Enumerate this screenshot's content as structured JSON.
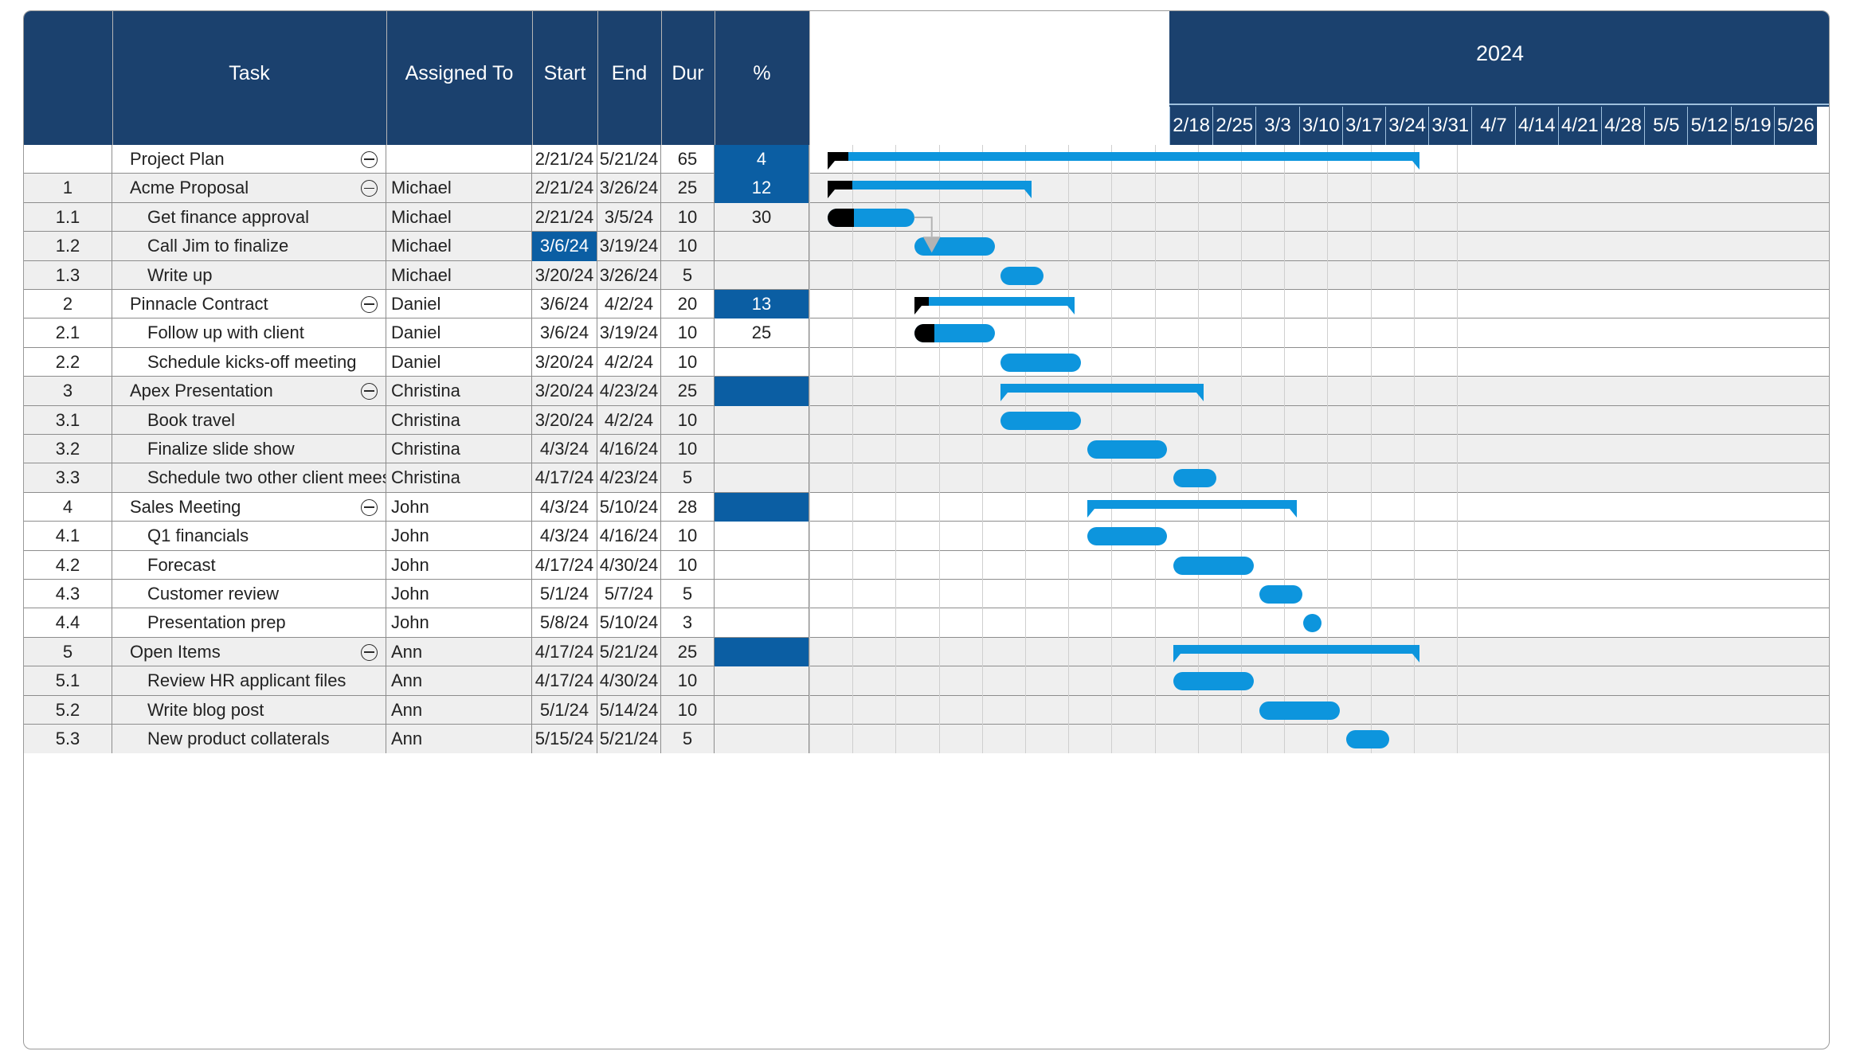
{
  "table": {
    "columns": [
      {
        "key": "id",
        "label": ""
      },
      {
        "key": "task",
        "label": "Task"
      },
      {
        "key": "assigned",
        "label": "Assigned To"
      },
      {
        "key": "start",
        "label": "Start"
      },
      {
        "key": "end",
        "label": "End"
      },
      {
        "key": "dur",
        "label": "Dur"
      },
      {
        "key": "pct",
        "label": "%"
      }
    ]
  },
  "timeline": {
    "year": "2024",
    "week_labels": [
      "2/18",
      "2/25",
      "3/3",
      "3/10",
      "3/17",
      "3/24",
      "3/31",
      "4/7",
      "4/14",
      "4/21",
      "4/28",
      "5/5",
      "5/12",
      "5/19",
      "5/26"
    ]
  },
  "colors": {
    "header_navy": "#1b416e",
    "highlight_blue": "#0b5ea3",
    "bar_blue": "#0d95dd",
    "progress_black": "#000000",
    "row_alt": "#efefef",
    "grid_line": "#8d8d8d"
  },
  "rows": [
    {
      "id": "",
      "task": "Project Plan",
      "level": 0,
      "summary": true,
      "collapse": true,
      "assigned": "",
      "start": "2/21/24",
      "end": "5/21/24",
      "dur": "65",
      "pct": "4",
      "pct_hl": true,
      "start_hl": false,
      "band": "white",
      "bar": {
        "type": "summary",
        "start_week": 0.43,
        "end_week": 14.14,
        "progress": 0.035
      }
    },
    {
      "id": "1",
      "task": "Acme Proposal",
      "level": 0,
      "summary": true,
      "collapse": true,
      "assigned": "Michael",
      "start": "2/21/24",
      "end": "3/26/24",
      "dur": "25",
      "pct": "12",
      "pct_hl": true,
      "start_hl": false,
      "band": "alt",
      "bar": {
        "type": "summary",
        "start_week": 0.43,
        "end_week": 5.14,
        "progress": 0.12
      }
    },
    {
      "id": "1.1",
      "task": "Get finance approval",
      "level": 1,
      "summary": false,
      "collapse": false,
      "assigned": "Michael",
      "start": "2/21/24",
      "end": "3/5/24",
      "dur": "10",
      "pct": "30",
      "pct_hl": false,
      "start_hl": false,
      "band": "alt",
      "bar": {
        "type": "task",
        "start_week": 0.43,
        "end_week": 2.43,
        "progress": 0.3
      }
    },
    {
      "id": "1.2",
      "task": "Call Jim to finalize",
      "level": 1,
      "summary": false,
      "collapse": false,
      "assigned": "Michael",
      "start": "3/6/24",
      "end": "3/19/24",
      "dur": "10",
      "pct": "",
      "pct_hl": false,
      "start_hl": true,
      "band": "alt",
      "bar": {
        "type": "task",
        "start_week": 2.43,
        "end_week": 4.29,
        "progress": 0
      }
    },
    {
      "id": "1.3",
      "task": "Write up",
      "level": 1,
      "summary": false,
      "collapse": false,
      "assigned": "Michael",
      "start": "3/20/24",
      "end": "3/26/24",
      "dur": "5",
      "pct": "",
      "pct_hl": false,
      "start_hl": false,
      "band": "alt",
      "bar": {
        "type": "task",
        "start_week": 4.43,
        "end_week": 5.43,
        "progress": 0
      }
    },
    {
      "id": "2",
      "task": "Pinnacle Contract",
      "level": 0,
      "summary": true,
      "collapse": true,
      "assigned": "Daniel",
      "start": "3/6/24",
      "end": "4/2/24",
      "dur": "20",
      "pct": "13",
      "pct_hl": true,
      "start_hl": false,
      "band": "white",
      "bar": {
        "type": "summary",
        "start_week": 2.43,
        "end_week": 6.14,
        "progress": 0.09
      }
    },
    {
      "id": "2.1",
      "task": "Follow up with client",
      "level": 1,
      "summary": false,
      "collapse": false,
      "assigned": "Daniel",
      "start": "3/6/24",
      "end": "3/19/24",
      "dur": "10",
      "pct": "25",
      "pct_hl": false,
      "start_hl": false,
      "band": "white",
      "bar": {
        "type": "task",
        "start_week": 2.43,
        "end_week": 4.29,
        "progress": 0.25
      }
    },
    {
      "id": "2.2",
      "task": "Schedule kicks-off meeting",
      "level": 1,
      "summary": false,
      "collapse": false,
      "assigned": "Daniel",
      "start": "3/20/24",
      "end": "4/2/24",
      "dur": "10",
      "pct": "",
      "pct_hl": false,
      "start_hl": false,
      "band": "white",
      "bar": {
        "type": "task",
        "start_week": 4.43,
        "end_week": 6.29,
        "progress": 0
      }
    },
    {
      "id": "3",
      "task": "Apex Presentation",
      "level": 0,
      "summary": true,
      "collapse": true,
      "assigned": "Christina",
      "start": "3/20/24",
      "end": "4/23/24",
      "dur": "25",
      "pct": "",
      "pct_hl": true,
      "start_hl": false,
      "band": "alt",
      "bar": {
        "type": "summary",
        "start_week": 4.43,
        "end_week": 9.14,
        "progress": 0
      }
    },
    {
      "id": "3.1",
      "task": "Book travel",
      "level": 1,
      "summary": false,
      "collapse": false,
      "assigned": "Christina",
      "start": "3/20/24",
      "end": "4/2/24",
      "dur": "10",
      "pct": "",
      "pct_hl": false,
      "start_hl": false,
      "band": "alt",
      "bar": {
        "type": "task",
        "start_week": 4.43,
        "end_week": 6.29,
        "progress": 0
      }
    },
    {
      "id": "3.2",
      "task": "Finalize slide show",
      "level": 1,
      "summary": false,
      "collapse": false,
      "assigned": "Christina",
      "start": "4/3/24",
      "end": "4/16/24",
      "dur": "10",
      "pct": "",
      "pct_hl": false,
      "start_hl": false,
      "band": "alt",
      "bar": {
        "type": "task",
        "start_week": 6.43,
        "end_week": 8.29,
        "progress": 0
      }
    },
    {
      "id": "3.3",
      "task": "Schedule two other client meestings",
      "level": 1,
      "summary": false,
      "collapse": false,
      "assigned": "Christina",
      "start": "4/17/24",
      "end": "4/23/24",
      "dur": "5",
      "pct": "",
      "pct_hl": false,
      "start_hl": false,
      "band": "alt",
      "bar": {
        "type": "task",
        "start_week": 8.43,
        "end_week": 9.43,
        "progress": 0
      }
    },
    {
      "id": "4",
      "task": "Sales Meeting",
      "level": 0,
      "summary": true,
      "collapse": true,
      "assigned": "John",
      "start": "4/3/24",
      "end": "5/10/24",
      "dur": "28",
      "pct": "",
      "pct_hl": true,
      "start_hl": false,
      "band": "white",
      "bar": {
        "type": "summary",
        "start_week": 6.43,
        "end_week": 11.29,
        "progress": 0
      }
    },
    {
      "id": "4.1",
      "task": "Q1 financials",
      "level": 1,
      "summary": false,
      "collapse": false,
      "assigned": "John",
      "start": "4/3/24",
      "end": "4/16/24",
      "dur": "10",
      "pct": "",
      "pct_hl": false,
      "start_hl": false,
      "band": "white",
      "bar": {
        "type": "task",
        "start_week": 6.43,
        "end_week": 8.29,
        "progress": 0
      }
    },
    {
      "id": "4.2",
      "task": "Forecast",
      "level": 1,
      "summary": false,
      "collapse": false,
      "assigned": "John",
      "start": "4/17/24",
      "end": "4/30/24",
      "dur": "10",
      "pct": "",
      "pct_hl": false,
      "start_hl": false,
      "band": "white",
      "bar": {
        "type": "task",
        "start_week": 8.43,
        "end_week": 10.29,
        "progress": 0
      }
    },
    {
      "id": "4.3",
      "task": "Customer review",
      "level": 1,
      "summary": false,
      "collapse": false,
      "assigned": "John",
      "start": "5/1/24",
      "end": "5/7/24",
      "dur": "5",
      "pct": "",
      "pct_hl": false,
      "start_hl": false,
      "band": "white",
      "bar": {
        "type": "task",
        "start_week": 10.43,
        "end_week": 11.43,
        "progress": 0
      }
    },
    {
      "id": "4.4",
      "task": "Presentation prep",
      "level": 1,
      "summary": false,
      "collapse": false,
      "assigned": "John",
      "start": "5/8/24",
      "end": "5/10/24",
      "dur": "3",
      "pct": "",
      "pct_hl": false,
      "start_hl": false,
      "band": "white",
      "bar": {
        "type": "task",
        "start_week": 11.43,
        "end_week": 11.86,
        "progress": 0
      }
    },
    {
      "id": "5",
      "task": "Open Items",
      "level": 0,
      "summary": true,
      "collapse": true,
      "assigned": "Ann",
      "start": "4/17/24",
      "end": "5/21/24",
      "dur": "25",
      "pct": "",
      "pct_hl": true,
      "start_hl": false,
      "band": "alt",
      "bar": {
        "type": "summary",
        "start_week": 8.43,
        "end_week": 14.14,
        "progress": 0
      }
    },
    {
      "id": "5.1",
      "task": "Review HR applicant files",
      "level": 1,
      "summary": false,
      "collapse": false,
      "assigned": "Ann",
      "start": "4/17/24",
      "end": "4/30/24",
      "dur": "10",
      "pct": "",
      "pct_hl": false,
      "start_hl": false,
      "band": "alt",
      "bar": {
        "type": "task",
        "start_week": 8.43,
        "end_week": 10.29,
        "progress": 0
      }
    },
    {
      "id": "5.2",
      "task": "Write blog post",
      "level": 1,
      "summary": false,
      "collapse": false,
      "assigned": "Ann",
      "start": "5/1/24",
      "end": "5/14/24",
      "dur": "10",
      "pct": "",
      "pct_hl": false,
      "start_hl": false,
      "band": "alt",
      "bar": {
        "type": "task",
        "start_week": 10.43,
        "end_week": 12.29,
        "progress": 0
      }
    },
    {
      "id": "5.3",
      "task": "New product collaterals",
      "level": 1,
      "summary": false,
      "collapse": false,
      "assigned": "Ann",
      "start": "5/15/24",
      "end": "5/21/24",
      "dur": "5",
      "pct": "",
      "pct_hl": false,
      "start_hl": false,
      "band": "alt",
      "bar": {
        "type": "task",
        "start_week": 12.43,
        "end_week": 13.43,
        "progress": 0
      }
    }
  ],
  "dependency": {
    "from_row": 2,
    "to_row": 3
  }
}
